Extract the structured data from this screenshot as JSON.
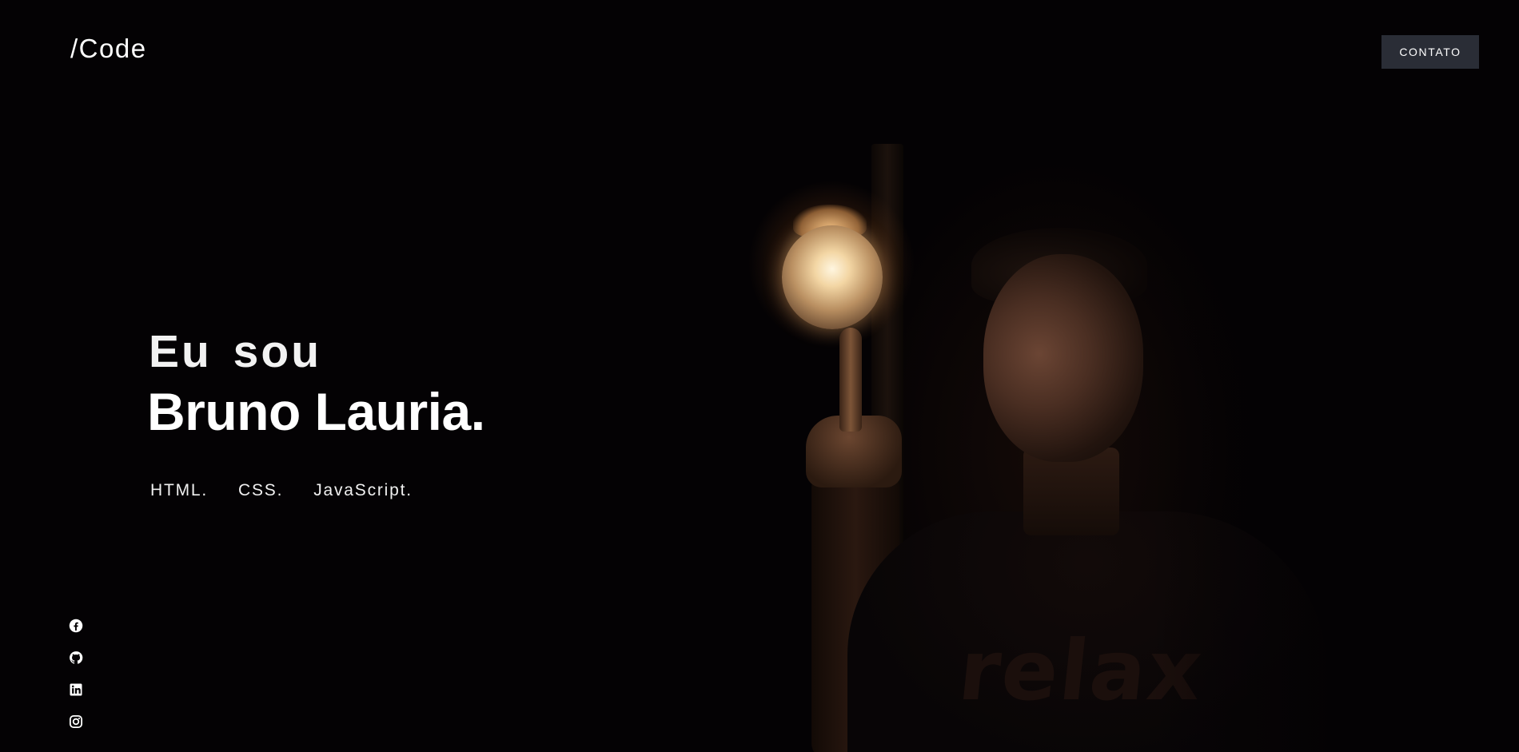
{
  "header": {
    "logo_slash": "/",
    "logo_text": "Code",
    "contact_label": "CONTATO"
  },
  "hero": {
    "greeting": "Eu sou",
    "name": "Bruno Lauria.",
    "skills": [
      "HTML.",
      "CSS.",
      "JavaScript."
    ],
    "photo_shirt_text": "relax"
  },
  "social": [
    {
      "icon": "facebook-icon"
    },
    {
      "icon": "github-icon"
    },
    {
      "icon": "linkedin-icon"
    },
    {
      "icon": "instagram-icon"
    }
  ],
  "colors": {
    "background": "#040204",
    "button_bg": "#2a2d36",
    "text": "#ffffff"
  }
}
